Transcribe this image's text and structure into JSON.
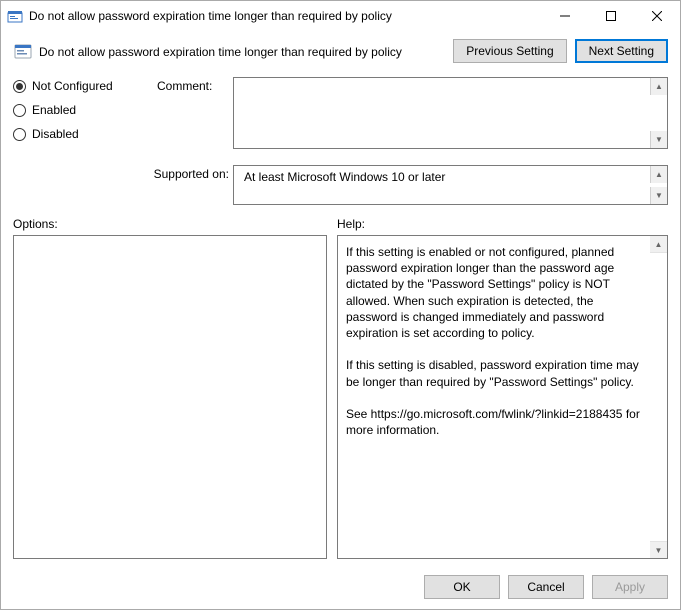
{
  "window": {
    "title": "Do not allow password expiration time longer than required by policy"
  },
  "header": {
    "policy_name": "Do not allow password expiration time longer than required by policy",
    "previous": "Previous Setting",
    "next": "Next Setting"
  },
  "state": {
    "options": {
      "not_configured": "Not Configured",
      "enabled": "Enabled",
      "disabled": "Disabled",
      "selected": "not_configured"
    },
    "comment_label": "Comment:",
    "comment_value": "",
    "supported_label": "Supported on:",
    "supported_value": "At least Microsoft Windows 10 or later"
  },
  "labels": {
    "options": "Options:",
    "help": "Help:"
  },
  "help_text": "If this setting is enabled or not configured, planned password expiration longer than the password age dictated by the \"Password Settings\" policy is NOT allowed. When such expiration is detected, the password is changed immediately and password expiration is set according to policy.\n\nIf this setting is disabled, password expiration time may be longer than required by \"Password Settings\" policy.\n\nSee https://go.microsoft.com/fwlink/?linkid=2188435 for more information.",
  "footer": {
    "ok": "OK",
    "cancel": "Cancel",
    "apply": "Apply"
  }
}
